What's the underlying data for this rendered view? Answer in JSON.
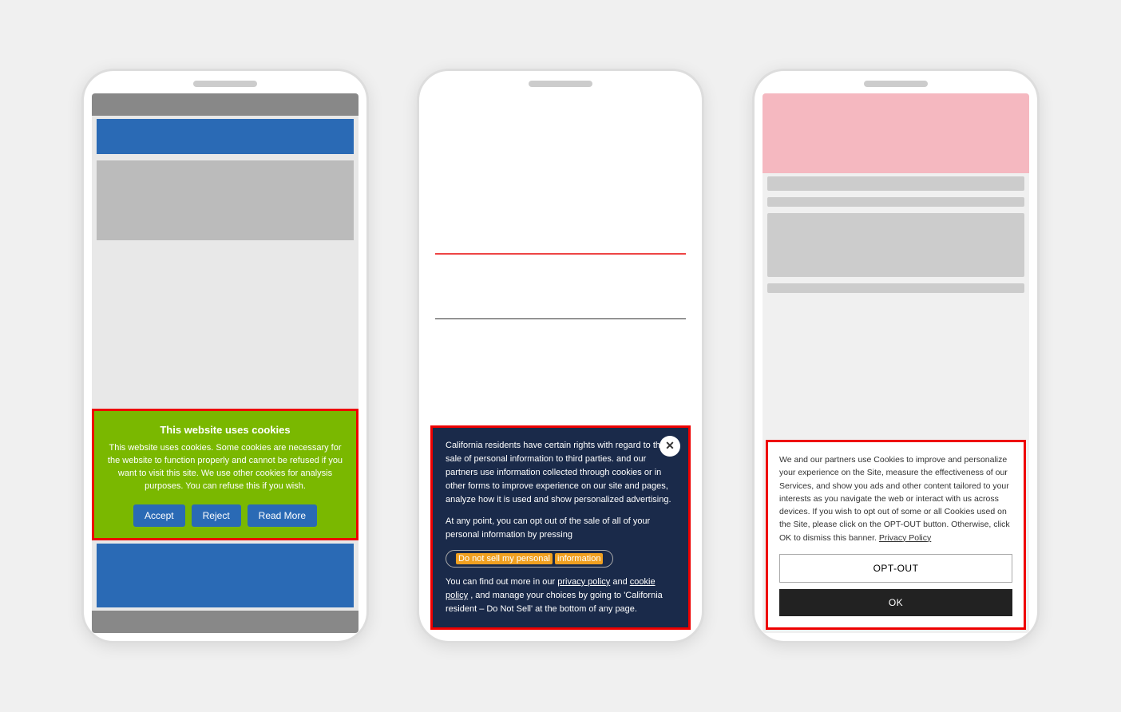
{
  "phone1": {
    "cookie_banner": {
      "title": "This website uses cookies",
      "body": "This website uses cookies. Some cookies are necessary for the website to function properly and cannot be refused if you want to visit this site. We use other cookies for analysis purposes. You can refuse this if you wish.",
      "btn_accept": "Accept",
      "btn_reject": "Reject",
      "btn_read_more": "Read More"
    }
  },
  "phone2": {
    "ccpa_banner": {
      "close_symbol": "✕",
      "para1": "California residents have certain rights with regard to the sale of personal information to third parties.",
      "para1_cont": "and our partners use information collected through cookies or in other forms to improve experience on our site and pages, analyze how it is used and show personalized advertising.",
      "para2": "At any point, you can opt out of the sale of all of your personal information by pressing",
      "do_not_sell_label": "Do not sell my personal",
      "do_not_sell_highlight": "information",
      "para3_pre": "You can find out more in our",
      "privacy_policy_link": "privacy policy",
      "para3_mid": "and",
      "cookie_policy_link": "cookie policy",
      "para3_post": ", and manage your choices by going to 'California resident – Do Not Sell' at the bottom of any page."
    }
  },
  "phone3": {
    "gdpr_banner": {
      "body": "We and our partners use Cookies to improve and personalize your experience on the Site, measure the effectiveness of our Services, and show you ads and other content tailored to your interests as you navigate the web or interact with us across devices. If you wish to opt out of some or all Cookies used on the Site, please click on the OPT-OUT button. Otherwise, click OK to dismiss this banner.",
      "privacy_policy_link": "Privacy Policy",
      "btn_optout": "OPT-OUT",
      "btn_ok": "OK"
    }
  }
}
